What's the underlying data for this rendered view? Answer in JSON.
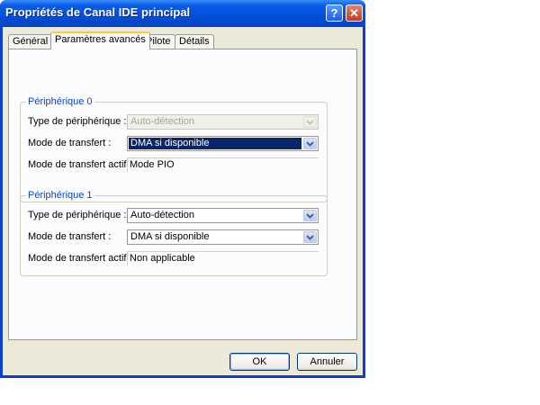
{
  "window": {
    "title": "Propriétés de Canal IDE principal",
    "help_label": "?",
    "close_label": "✕"
  },
  "tabs": [
    {
      "label": "Général"
    },
    {
      "label": "Paramètres avancés"
    },
    {
      "label": "Pilote"
    },
    {
      "label": "Détails"
    }
  ],
  "groups": [
    {
      "legend": "Périphérique 0",
      "device_type_label": "Type de périphérique :",
      "device_type_value": "Auto-détection",
      "transfer_mode_label": "Mode de transfert :",
      "transfer_mode_value": "DMA si disponible",
      "active_mode_label": "Mode de transfert actif :",
      "active_mode_value": "Mode PIO"
    },
    {
      "legend": "Périphérique 1",
      "device_type_label": "Type de périphérique :",
      "device_type_value": "Auto-détection",
      "transfer_mode_label": "Mode de transfert :",
      "transfer_mode_value": "DMA si disponible",
      "active_mode_label": "Mode de transfert actif :",
      "active_mode_value": "Non applicable"
    }
  ],
  "buttons": {
    "ok": "OK",
    "cancel": "Annuler"
  },
  "colors": {
    "title_bar": "#0350d8",
    "dialog_bg": "#ece9d8",
    "group_legend": "#0046d5",
    "selection": "#0a246a"
  }
}
